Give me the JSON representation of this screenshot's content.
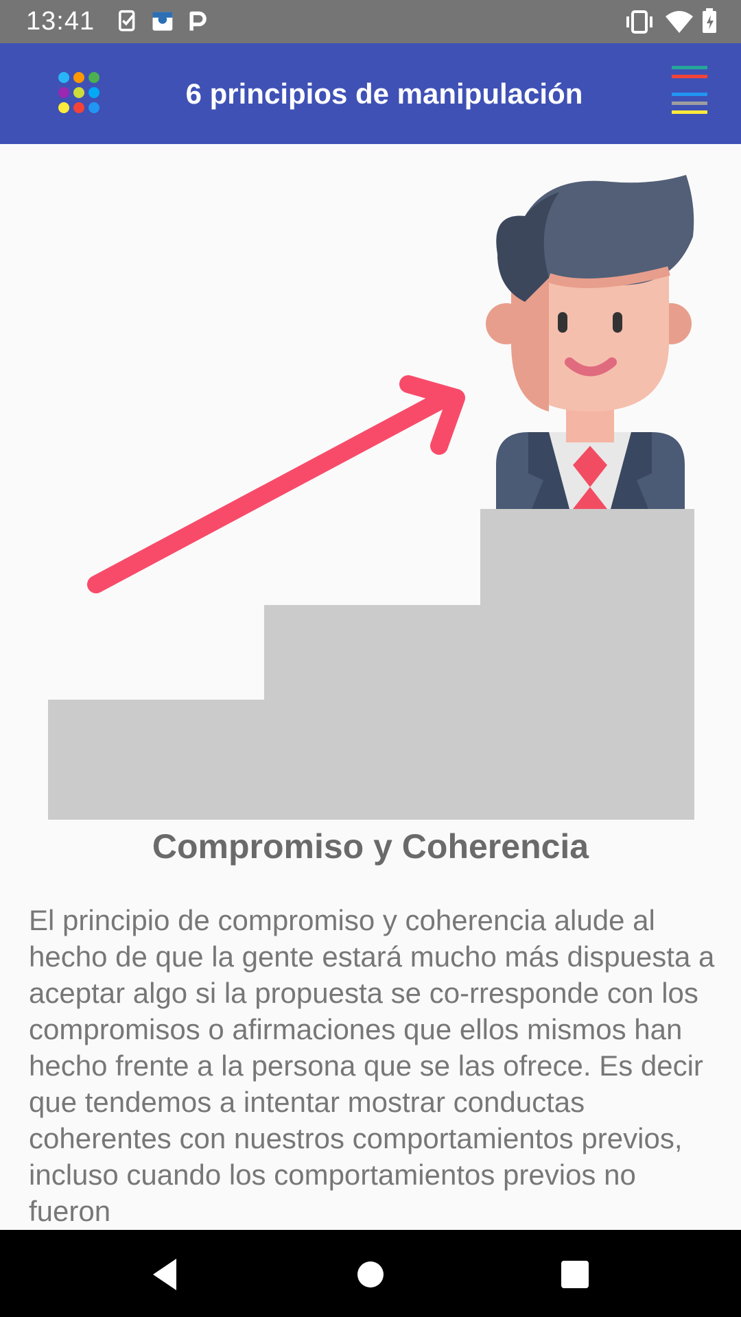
{
  "status_bar": {
    "time": "13:41",
    "left_icons": [
      "task-check-icon",
      "calendar-app-icon",
      "p-app-icon"
    ],
    "right_icons": [
      "vibrate-icon",
      "wifi-icon",
      "battery-charging-icon"
    ]
  },
  "app_bar": {
    "title": "6 principios de manipulación",
    "background_color": "#3f51b5",
    "left_icon": "colored-dots-grid-icon",
    "right_icon": "colored-bars-menu-icon"
  },
  "content": {
    "illustration": "businessman-on-stairs-illustration",
    "heading": "Compromiso y Coherencia",
    "body": "El principio de compromiso y coherencia alude al hecho de que la gente estará mucho más dispuesta a aceptar algo si la propuesta se co-rresponde con los compromisos o afirmaciones que ellos mismos han hecho frente a la persona que se las ofrece. Es decir que tendemos a intentar mostrar conductas coherentes con nuestros comportamientos previos, incluso cuando los comportamientos previos no fueron"
  },
  "nav_bar": {
    "buttons": [
      "back-icon",
      "home-icon",
      "recents-icon"
    ]
  }
}
